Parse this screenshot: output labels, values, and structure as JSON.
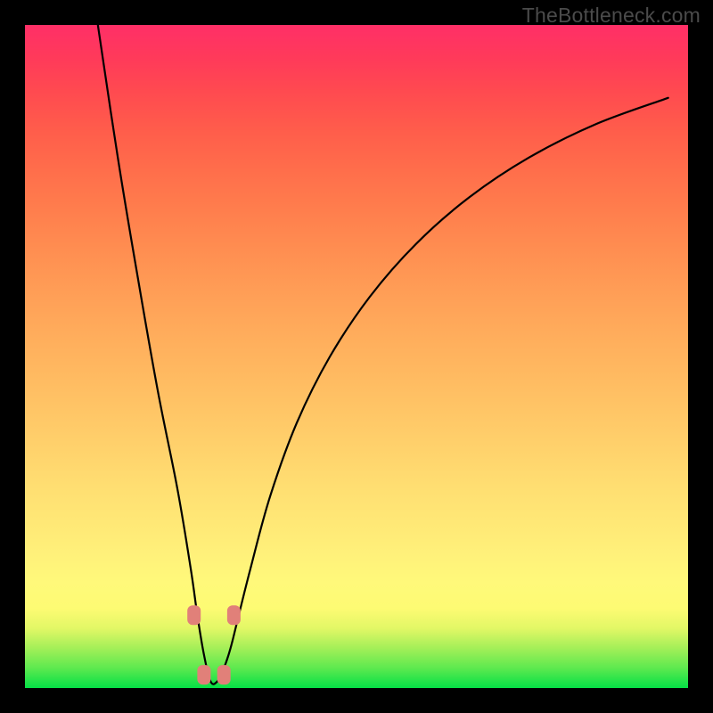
{
  "watermark": "TheBottleneck.com",
  "chart_data": {
    "type": "line",
    "title": "",
    "xlabel": "",
    "ylabel": "",
    "xlim": [
      0,
      100
    ],
    "ylim": [
      0,
      100
    ],
    "note": "Approximate V-shaped bottleneck curve; minimum near x≈28 where y≈0. Values read from curve shape against full-plot axes (no tick labels present).",
    "x": [
      11,
      14,
      17,
      20,
      23,
      25,
      26,
      27,
      28,
      29,
      30,
      31,
      32,
      34,
      37,
      41,
      46,
      52,
      59,
      67,
      76,
      86,
      97
    ],
    "values": [
      100,
      80,
      62,
      45,
      30,
      18,
      11,
      5,
      1,
      1,
      3,
      6,
      10,
      18,
      29,
      40,
      50,
      59,
      67,
      74,
      80,
      85,
      89
    ],
    "markers": {
      "note": "Highlighted points near curve minimum",
      "points": [
        {
          "x": 25.5,
          "y": 11
        },
        {
          "x": 31.5,
          "y": 11
        },
        {
          "x": 27.0,
          "y": 2
        },
        {
          "x": 30.0,
          "y": 2
        }
      ]
    }
  }
}
